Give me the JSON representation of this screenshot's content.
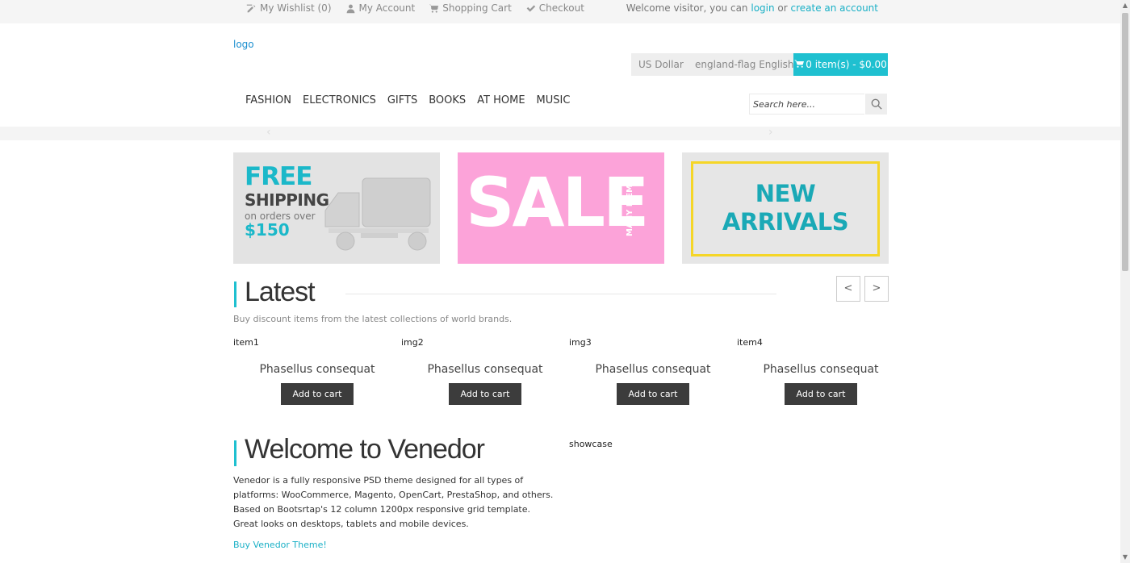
{
  "topbar": {
    "links": [
      {
        "label": "My Wishlist (0)",
        "icon": "edit-icon"
      },
      {
        "label": "My Account",
        "icon": "user-icon"
      },
      {
        "label": "Shopping Cart",
        "icon": "cart-icon"
      },
      {
        "label": "Checkout",
        "icon": "check-icon"
      }
    ],
    "welcome_prefix": "Welcome visitor, you can ",
    "login_label": "login",
    "or_text": " or ",
    "create_account_label": "create an account"
  },
  "header": {
    "logo_text": "logo",
    "currency_label": "US Dollar",
    "language_label": "england-flag English",
    "cart_label": "0 item(s) - $0.00",
    "accent_color": "#1fc0d0"
  },
  "nav": {
    "items": [
      "FASHION",
      "ELECTRONICS",
      "GIFTS",
      "BOOKS",
      "AT HOME",
      "MUSIC"
    ]
  },
  "search": {
    "placeholder": "Search here..."
  },
  "banners": {
    "free_shipping": {
      "line1": "FREE",
      "line2": "SHIPPING",
      "line3": "on orders over",
      "line4": "$150"
    },
    "sale": {
      "big": "SALE",
      "side": "MANY ITEMS"
    },
    "new_arrivals": {
      "line1": "NEW",
      "line2": "ARRIVALS"
    }
  },
  "latest": {
    "title": "Latest",
    "subtitle": "Buy discount items from the latest collections of world brands.",
    "prev_label": "<",
    "next_label": ">",
    "products": [
      {
        "image_alt": "item1",
        "name": "Phasellus consequat",
        "button": "Add to cart"
      },
      {
        "image_alt": "img2",
        "name": "Phasellus consequat",
        "button": "Add to cart"
      },
      {
        "image_alt": "img3",
        "name": "Phasellus consequat",
        "button": "Add to cart"
      },
      {
        "image_alt": "item4",
        "name": "Phasellus consequat",
        "button": "Add to cart"
      }
    ]
  },
  "welcome_section": {
    "title": "Welcome to Venedor",
    "body": "Venedor is a fully responsive PSD theme designed for all types of platforms: WooCommerce, Magento, OpenCart, PrestaShop, and others. Based on Bootsrtap's 12 column 1200px responsive grid template. Great looks on desktops, tablets and mobile devices.",
    "link": "Buy Venedor Theme!",
    "showcase_alt": "showcase"
  }
}
